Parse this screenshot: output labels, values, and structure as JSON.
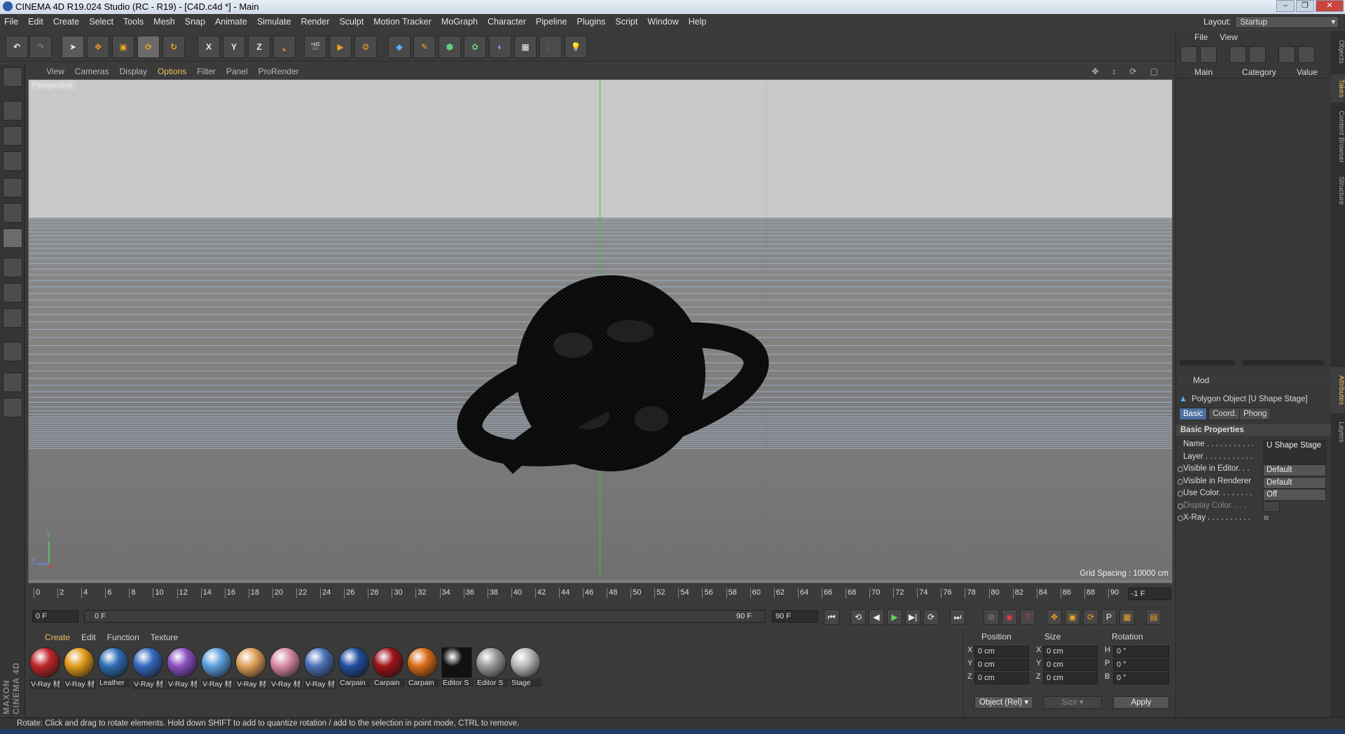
{
  "window": {
    "title": "CINEMA 4D R19.024 Studio (RC - R19) - [C4D.c4d *] - Main"
  },
  "menubar": [
    "File",
    "Edit",
    "Create",
    "Select",
    "Tools",
    "Mesh",
    "Snap",
    "Animate",
    "Simulate",
    "Render",
    "Sculpt",
    "Motion Tracker",
    "MoGraph",
    "Character",
    "Pipeline",
    "Plugins",
    "Script",
    "Window",
    "Help"
  ],
  "layout": {
    "label": "Layout:",
    "value": "Startup"
  },
  "toolbar": {
    "axis_x": "X",
    "axis_y": "Y",
    "axis_z": "Z"
  },
  "viewport": {
    "menu": [
      "View",
      "Cameras",
      "Display",
      "Options",
      "Filter",
      "Panel",
      "ProRender"
    ],
    "highlight": "Options",
    "label": "Perspective",
    "grid_spacing": "Grid Spacing : 10000 cm",
    "axis_y": "Y",
    "axis_z": "Z"
  },
  "timeline": {
    "ticks": [
      "0",
      "2",
      "4",
      "6",
      "8",
      "10",
      "12",
      "14",
      "16",
      "18",
      "20",
      "22",
      "24",
      "26",
      "28",
      "30",
      "32",
      "34",
      "36",
      "38",
      "40",
      "42",
      "44",
      "46",
      "48",
      "50",
      "52",
      "54",
      "56",
      "58",
      "60",
      "62",
      "64",
      "66",
      "68",
      "70",
      "72",
      "74",
      "76",
      "78",
      "80",
      "82",
      "84",
      "86",
      "88",
      "90"
    ],
    "current_frame_field": "-1 F",
    "start": "0 F",
    "range_start": "0 F",
    "range_end": "90 F",
    "end": "90 F"
  },
  "materials": {
    "menu": [
      "Create",
      "Edit",
      "Function",
      "Texture"
    ],
    "items": [
      {
        "name": "V-Ray 材",
        "color": "#c0262a"
      },
      {
        "name": "V-Ray 材",
        "color": "#e39c1c"
      },
      {
        "name": "Leather",
        "color": "#2f6db5"
      },
      {
        "name": "V-Ray 材",
        "color": "#3468c0"
      },
      {
        "name": "V-Ray 材",
        "color": "#8a4fc0"
      },
      {
        "name": "V-Ray 材",
        "color": "#5aa0dc"
      },
      {
        "name": "V-Ray 材",
        "color": "#e0a05a"
      },
      {
        "name": "V-Ray 材",
        "color": "#d88aa6"
      },
      {
        "name": "V-Ray 材",
        "color": "#4b72b8"
      },
      {
        "name": "Carpain",
        "color": "#1f4fa0"
      },
      {
        "name": "Carpain",
        "color": "#a0121a"
      },
      {
        "name": "Carpain",
        "color": "#d86a18"
      },
      {
        "name": "Editor S",
        "color": "#111111"
      },
      {
        "name": "Editor S",
        "color": "#9a9a9a"
      },
      {
        "name": "Stage",
        "color": "#b8b8b8"
      }
    ]
  },
  "coords": {
    "headers": {
      "position": "Position",
      "size": "Size",
      "rotation": "Rotation"
    },
    "rows": [
      {
        "axis": "X",
        "pos": "0 cm",
        "saxis": "X",
        "size": "0 cm",
        "raxis": "H",
        "rot": "0 °"
      },
      {
        "axis": "Y",
        "pos": "0 cm",
        "saxis": "Y",
        "size": "0 cm",
        "raxis": "P",
        "rot": "0 °"
      },
      {
        "axis": "Z",
        "pos": "0 cm",
        "saxis": "Z",
        "size": "0 cm",
        "raxis": "B",
        "rot": "0 °"
      }
    ],
    "mode": "Object (Rel)",
    "size_mode": "Size",
    "apply": "Apply"
  },
  "objects": {
    "menu": [
      "File",
      "View"
    ],
    "columns": {
      "main": "Main",
      "category": "Category",
      "value": "Value"
    }
  },
  "attributes": {
    "mode": "Mod",
    "object_title": "Polygon Object [U Shape Stage]",
    "tabs": [
      "Basic",
      "Coord.",
      "Phong"
    ],
    "section": "Basic Properties",
    "props": [
      {
        "label": "Name . . . . . . . . . . .",
        "value": "U Shape Stage"
      },
      {
        "label": "Layer . . . . . . . . . . .",
        "value": ""
      },
      {
        "label": "Visible in Editor. . .",
        "value": "Default"
      },
      {
        "label": "Visible in Renderer",
        "value": "Default"
      },
      {
        "label": "Use Color. . . . . . . .",
        "value": "Off"
      },
      {
        "label": "Display Color. . . .",
        "value": ""
      },
      {
        "label": "X-Ray . . . . . . . . . .",
        "value": ""
      }
    ]
  },
  "side_tabs": [
    "Objects",
    "Takes",
    "Content Browser",
    "Structure",
    "Attributes",
    "Layers"
  ],
  "status": "Rotate: Click and drag to rotate elements. Hold down SHIFT to add to quantize rotation / add to the selection in point mode, CTRL to remove.",
  "brand": "MAXON CINEMA 4D"
}
